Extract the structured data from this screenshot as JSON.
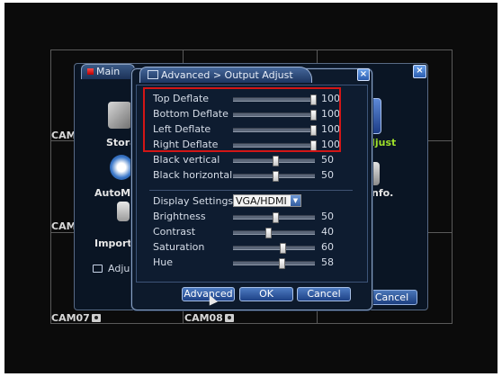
{
  "background": {
    "cameras": [
      {
        "id": "cam-tl",
        "label": "CAM"
      },
      {
        "id": "cam-ml",
        "label": "CAM"
      },
      {
        "id": "cam07",
        "label": "CAM07"
      },
      {
        "id": "cam08",
        "label": "CAM08"
      }
    ]
  },
  "main_menu": {
    "title": "Main",
    "items": {
      "storage": "Stora",
      "adjust": "djust",
      "automa": "AutoMa",
      "info": "nfo.",
      "import": "Import/E",
      "adju": "Adju"
    },
    "cancel_label": "Cancel"
  },
  "dialog": {
    "title": "Advanced > Output Adjust",
    "close_label": "×",
    "sliders_top": [
      {
        "label": "Top Deflate",
        "value": "100",
        "level": 1.0
      },
      {
        "label": "Bottom Deflate",
        "value": "100",
        "level": 1.0
      },
      {
        "label": "Left Deflate",
        "value": "100",
        "level": 1.0
      },
      {
        "label": "Right Deflate",
        "value": "100",
        "level": 1.0
      },
      {
        "label": "Black vertical",
        "value": "50",
        "level": 0.5
      },
      {
        "label": "Black horizontal",
        "value": "50",
        "level": 0.5
      }
    ],
    "display_settings": {
      "label": "Display Settings",
      "value": "VGA/HDMI"
    },
    "sliders_bottom": [
      {
        "label": "Brightness",
        "value": "50",
        "level": 0.5
      },
      {
        "label": "Contrast",
        "value": "40",
        "level": 0.4
      },
      {
        "label": "Saturation",
        "value": "60",
        "level": 0.6
      },
      {
        "label": "Hue",
        "value": "58",
        "level": 0.58
      }
    ],
    "buttons": {
      "advanced": "Advanced",
      "ok": "OK",
      "cancel": "Cancel"
    }
  },
  "colors": {
    "highlight": "#d21616",
    "adjust_text": "#9fe02a"
  }
}
